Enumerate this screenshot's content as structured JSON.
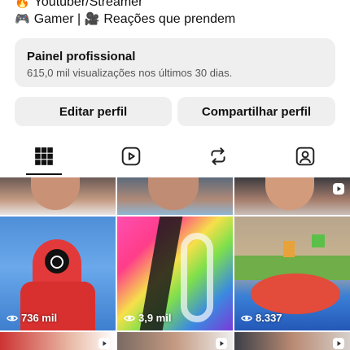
{
  "bio": {
    "line1_emoji": "🔥",
    "line1_text": "Youtuber/Streamer",
    "line2_emoji1": "🎮",
    "line2_text1": "Gamer | ",
    "line2_emoji2": "🎥",
    "line2_text2": "Reações que prendem"
  },
  "panel": {
    "title": "Painel profissional",
    "subtitle": "615,0 mil visualizações nos últimos 30 dias."
  },
  "actions": {
    "edit": "Editar perfil",
    "share": "Compartilhar perfil"
  },
  "tabs": [
    {
      "icon": "grid-icon",
      "active": true
    },
    {
      "icon": "reels-icon",
      "active": false
    },
    {
      "icon": "repost-icon",
      "active": false
    },
    {
      "icon": "tagged-icon",
      "active": false
    }
  ],
  "posts": [
    {
      "views": "736 mil"
    },
    {
      "views": "3,9 mil"
    },
    {
      "views": "8.337"
    }
  ],
  "colors": {
    "panel_bg": "#efefef",
    "text": "#111111",
    "muted": "#555555"
  }
}
